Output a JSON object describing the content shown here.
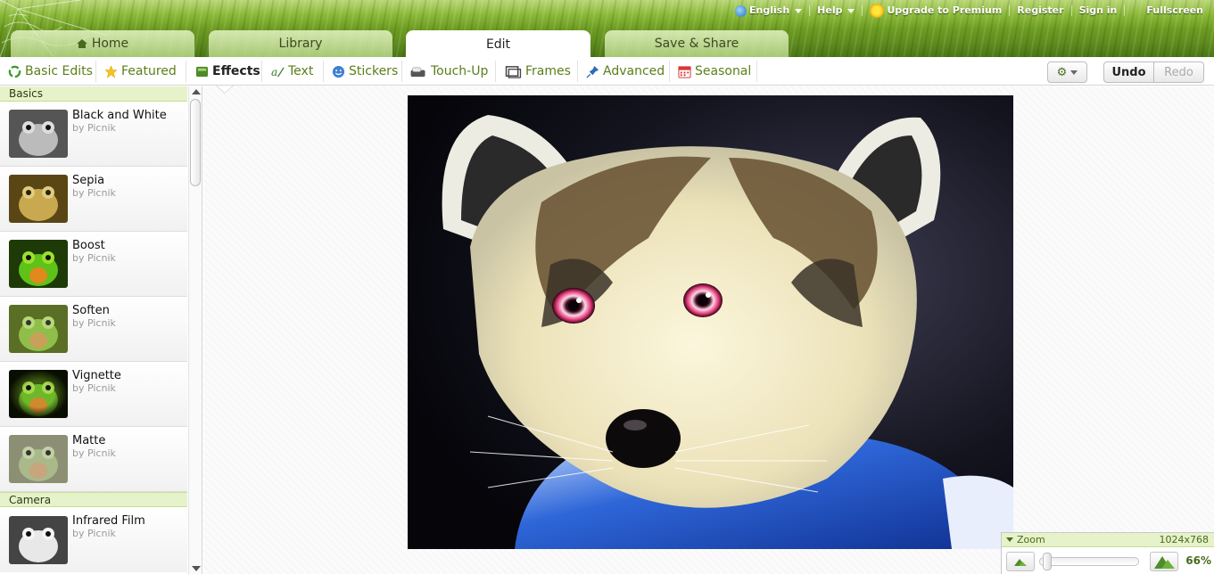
{
  "top_nav": {
    "language": "English",
    "help": "Help",
    "upgrade": "Upgrade to Premium",
    "register": "Register",
    "sign_in": "Sign in",
    "fullscreen": "Fullscreen"
  },
  "tabs": [
    {
      "label": "Home",
      "icon": "home-icon"
    },
    {
      "label": "Library"
    },
    {
      "label": "Edit",
      "active": true
    },
    {
      "label": "Save & Share"
    }
  ],
  "toolbar": {
    "items": [
      {
        "label": "Basic Edits",
        "icon": "recycle-icon"
      },
      {
        "label": "Featured",
        "icon": "star-icon"
      },
      {
        "label": "Effects",
        "icon": "effects-icon",
        "active": true
      },
      {
        "label": "Text",
        "icon": "text-icon"
      },
      {
        "label": "Stickers",
        "icon": "smiley-icon"
      },
      {
        "label": "Touch-Up",
        "icon": "lipstick-icon"
      },
      {
        "label": "Frames",
        "icon": "frame-icon"
      },
      {
        "label": "Advanced",
        "icon": "pin-icon"
      },
      {
        "label": "Seasonal",
        "icon": "calendar-icon"
      }
    ],
    "undo": "Undo",
    "redo": "Redo"
  },
  "sidebar": {
    "sections": [
      {
        "title": "Basics",
        "effects": [
          {
            "name": "Black and White",
            "by": "by Picnik"
          },
          {
            "name": "Sepia",
            "by": "by Picnik"
          },
          {
            "name": "Boost",
            "by": "by Picnik"
          },
          {
            "name": "Soften",
            "by": "by Picnik"
          },
          {
            "name": "Vignette",
            "by": "by Picnik"
          },
          {
            "name": "Matte",
            "by": "by Picnik"
          }
        ]
      },
      {
        "title": "Camera",
        "effects": [
          {
            "name": "Infrared Film",
            "by": "by Picnik"
          }
        ]
      }
    ]
  },
  "zoom": {
    "label": "Zoom",
    "dimensions": "1024x768",
    "percent": "66%",
    "level": 0.02
  },
  "colors": {
    "accent_green": "#5b7e19",
    "section_bg": "#e6f2c9"
  }
}
